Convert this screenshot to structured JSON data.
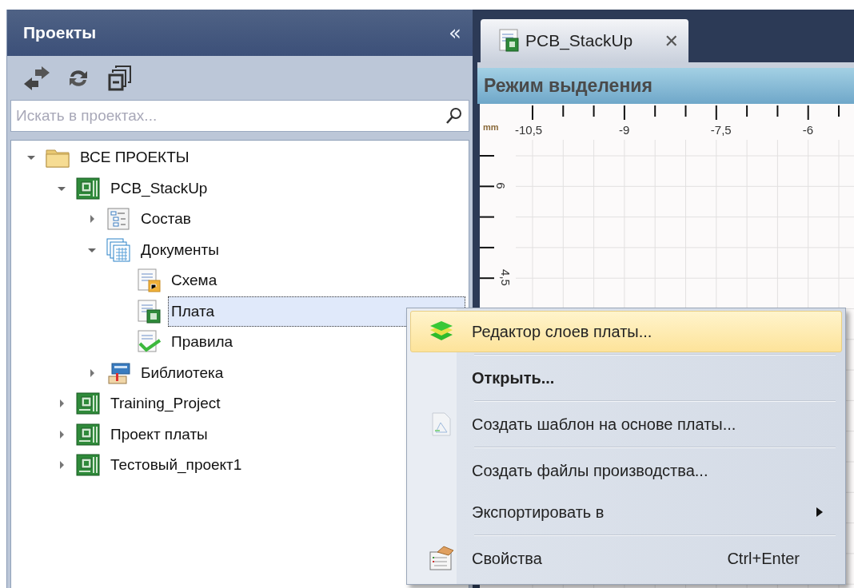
{
  "projects_panel": {
    "title": "Проекты",
    "collapse_glyph": "«",
    "search": {
      "placeholder": "Искать в проектах..."
    },
    "tree": [
      {
        "label": "ВСЕ ПРОЕКТЫ",
        "kind": "folder",
        "expanded": true,
        "selected": false,
        "children": [
          {
            "label": "PCB_StackUp",
            "kind": "project",
            "expanded": true,
            "selected": false,
            "children": [
              {
                "label": "Состав",
                "kind": "structure",
                "expanded": false,
                "selected": false
              },
              {
                "label": "Документы",
                "kind": "documents",
                "expanded": true,
                "selected": false,
                "children": [
                  {
                    "label": "Схема",
                    "kind": "schematic",
                    "selected": false
                  },
                  {
                    "label": "Плата",
                    "kind": "board",
                    "selected": true
                  },
                  {
                    "label": "Правила",
                    "kind": "rules",
                    "selected": false
                  }
                ]
              },
              {
                "label": "Библиотека",
                "kind": "library",
                "expanded": false,
                "selected": false
              }
            ]
          },
          {
            "label": "Training_Project",
            "kind": "project",
            "expanded": false,
            "selected": false
          },
          {
            "label": "Проект платы",
            "kind": "project",
            "expanded": false,
            "selected": false
          },
          {
            "label": "Тестовый_проект1",
            "kind": "project",
            "expanded": false,
            "selected": false
          }
        ]
      }
    ]
  },
  "editor": {
    "tabs": [
      {
        "label": "PCB_StackUp",
        "selected": true,
        "close_glyph": "✕"
      }
    ],
    "mode_title": "Режим выделения",
    "ruler": {
      "unit": "mm",
      "x_labels": [
        "-10,5",
        "-9",
        "-7,5",
        "-6"
      ],
      "y_labels": [
        "6",
        "4,5"
      ]
    }
  },
  "context_menu": [
    {
      "label": "Редактор слоев платы...",
      "kind": "layers",
      "selected": true,
      "bold": false,
      "divider_above": false
    },
    {
      "label": "Открыть...",
      "kind": "plain",
      "selected": false,
      "bold": true,
      "divider_above": true
    },
    {
      "label": "Создать шаблон на основе платы...",
      "kind": "template",
      "selected": false,
      "bold": false,
      "divider_above": true
    },
    {
      "label": "Создать файлы производства...",
      "kind": "plain",
      "selected": false,
      "bold": false,
      "divider_above": true
    },
    {
      "label": "Экспортировать в",
      "kind": "plain",
      "selected": false,
      "bold": false,
      "divider_above": false,
      "submenu": true
    },
    {
      "label": "Свойства",
      "kind": "properties",
      "shortcut": "Ctrl+Enter",
      "selected": false,
      "bold": false,
      "divider_above": true
    }
  ]
}
